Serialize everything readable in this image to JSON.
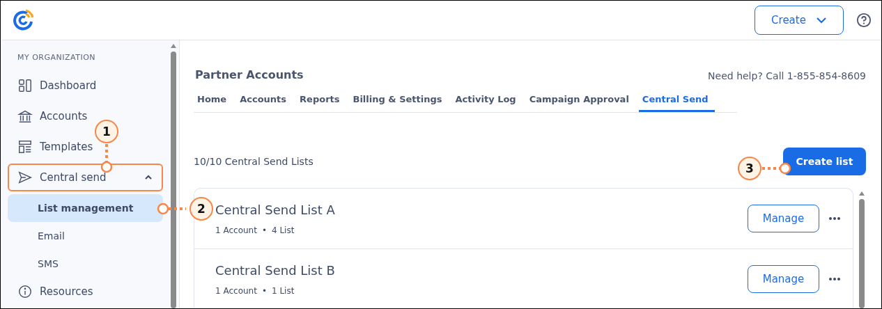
{
  "header": {
    "create_button": "Create"
  },
  "sidebar": {
    "section": "MY ORGANIZATION",
    "items": [
      {
        "label": "Dashboard",
        "selected": false,
        "highlighted": false
      },
      {
        "label": "Accounts",
        "selected": false,
        "highlighted": false
      },
      {
        "label": "Templates",
        "selected": false,
        "highlighted": false
      },
      {
        "label": "Central send",
        "selected": false,
        "highlighted": true,
        "expanded": true,
        "children": [
          {
            "label": "List management",
            "selected": true,
            "highlighted": false
          },
          {
            "label": "Email",
            "selected": false,
            "highlighted": false
          },
          {
            "label": "SMS",
            "selected": false,
            "highlighted": false
          }
        ]
      },
      {
        "label": "Resources",
        "selected": false,
        "highlighted": false
      }
    ]
  },
  "page": {
    "title": "Partner Accounts",
    "help": "Need help? Call 1-855-854-8609",
    "tabs": [
      {
        "label": "Home",
        "selected": false
      },
      {
        "label": "Accounts",
        "selected": false
      },
      {
        "label": "Reports",
        "selected": false
      },
      {
        "label": "Billing & Settings",
        "selected": false
      },
      {
        "label": "Activity Log",
        "selected": false
      },
      {
        "label": "Campaign Approval",
        "selected": false
      },
      {
        "label": "Central Send",
        "selected": true
      }
    ],
    "count": "10/10 Central Send Lists",
    "create_list_button": "Create list",
    "lists": [
      {
        "title": "Central Send List A",
        "accounts": "1 Account",
        "separator": "•",
        "lists": "4 List",
        "action": "Manage"
      },
      {
        "title": "Central Send List B",
        "accounts": "1 Account",
        "separator": "•",
        "lists": "1 List",
        "action": "Manage"
      }
    ]
  },
  "callouts": [
    {
      "number": "1"
    },
    {
      "number": "2"
    },
    {
      "number": "3"
    }
  ]
}
